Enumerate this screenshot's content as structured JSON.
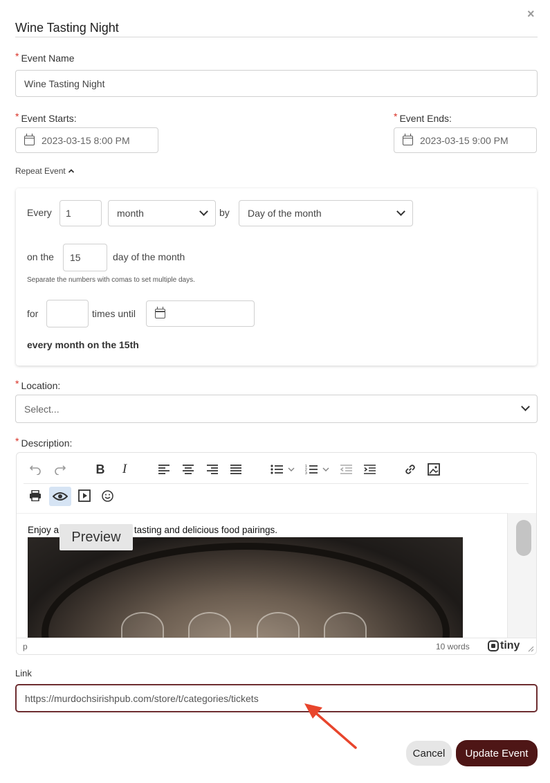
{
  "modal": {
    "title": "Wine Tasting Night",
    "close_label": "×"
  },
  "event_name": {
    "label": "Event Name",
    "value": "Wine Tasting Night",
    "required": "*"
  },
  "event_starts": {
    "label": "Event Starts:",
    "value": "2023-03-15 8:00 PM",
    "required": "*"
  },
  "event_ends": {
    "label": "Event Ends:",
    "value": "2023-03-15 9:00 PM",
    "required": "*"
  },
  "repeat": {
    "toggle_label": "Repeat Event",
    "every_label": "Every",
    "interval_value": "1",
    "unit_value": "month",
    "by_label": "by",
    "by_value": "Day of the month",
    "on_the_label": "on the",
    "day_value": "15",
    "day_suffix": "day of the month",
    "hint": "Separate the numbers with comas to set multiple days.",
    "for_label": "for",
    "times_value": "",
    "times_until_label": "times until",
    "until_value": "",
    "summary": "every month on the 15th"
  },
  "location": {
    "label": "Location:",
    "placeholder": "Select...",
    "required": "*"
  },
  "description": {
    "label": "Description:",
    "required": "*",
    "content_text": "Enjoy an evening of wine tasting and delicious food pairings.",
    "tooltip": "Preview",
    "status_path": "p",
    "word_count": "10 words",
    "brand": "tiny"
  },
  "link": {
    "label": "Link",
    "value": "https://murdochsirishpub.com/store/t/categories/tickets"
  },
  "buttons": {
    "cancel": "Cancel",
    "update": "Update Event"
  },
  "colors": {
    "accent": "#4e1616",
    "link_border": "#6d2d30",
    "required": "#d93025",
    "arrow": "#e8452c"
  }
}
